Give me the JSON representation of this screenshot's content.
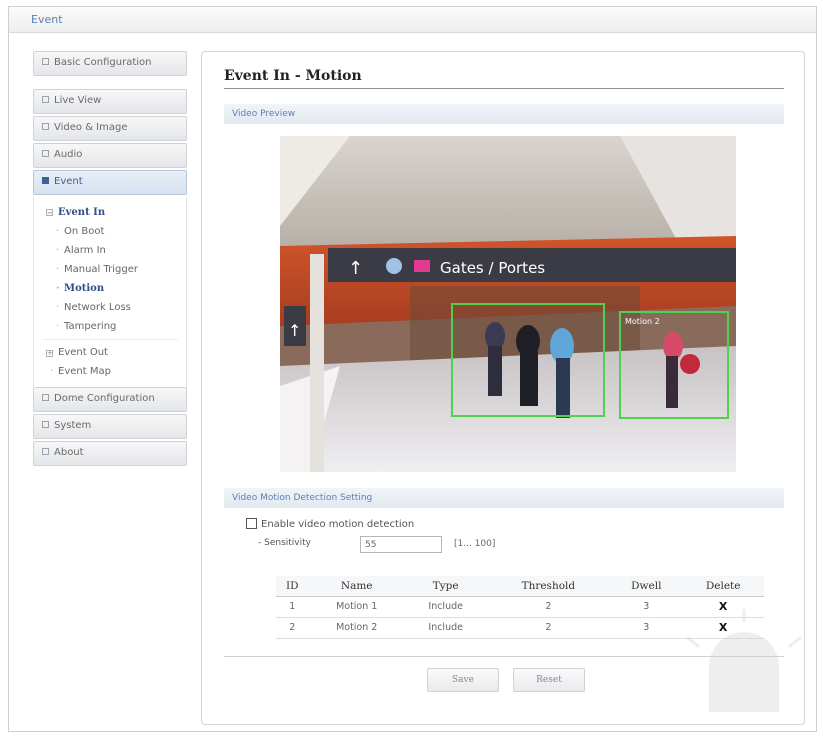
{
  "window": {
    "title": "Event"
  },
  "sidebar": {
    "basic_configuration": "Basic Configuration",
    "live_view": "Live View",
    "video_image": "Video & Image",
    "audio": "Audio",
    "event": "Event",
    "event_in": "Event In",
    "event_in_items": [
      "On Boot",
      "Alarm In",
      "Manual Trigger",
      "Motion",
      "Network Loss",
      "Tampering"
    ],
    "event_out": "Event Out",
    "event_map": "Event Map",
    "dome_configuration": "Dome Configuration",
    "system": "System",
    "about": "About"
  },
  "main": {
    "title": "Event In - Motion",
    "video_preview_label": "Video Preview",
    "video": {
      "sign_text": "Gates / Portes",
      "region_label": "Motion 2"
    },
    "detection_section_label": "Video Motion Detection Setting",
    "enable_label": "Enable video motion detection",
    "sensitivity_label": "- Sensitivity",
    "sensitivity_value": "55",
    "sensitivity_range": "[1... 100]",
    "table": {
      "headers": [
        "ID",
        "Name",
        "Type",
        "Threshold",
        "Dwell",
        "Delete"
      ],
      "rows": [
        [
          "1",
          "Motion 1",
          "Include",
          "2",
          "3",
          "X"
        ],
        [
          "2",
          "Motion 2",
          "Include",
          "2",
          "3",
          "X"
        ]
      ]
    },
    "save_label": "Save",
    "reset_label": "Reset"
  },
  "colors": {
    "accent_blue": "#5b7fb3",
    "motion_region_green": "#4fd14f"
  }
}
